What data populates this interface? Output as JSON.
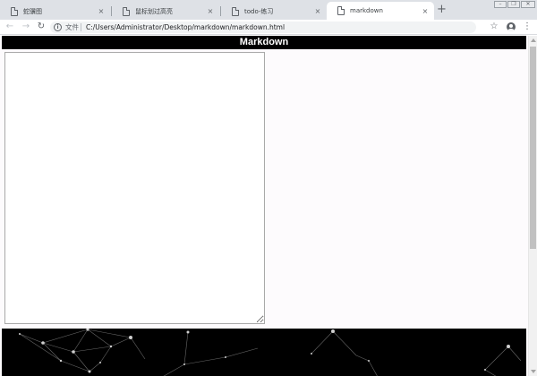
{
  "browser": {
    "tabs": [
      {
        "title": "蛇骥图",
        "close": "×",
        "active": false
      },
      {
        "title": "鼠标划过高亮",
        "close": "×",
        "active": false
      },
      {
        "title": "todo-练习",
        "close": "×",
        "active": false
      },
      {
        "title": "markdown",
        "close": "×",
        "active": true
      }
    ],
    "new_tab": "+",
    "window_controls": {
      "minimize": "–",
      "restore": "❐",
      "close": "✕"
    },
    "toolbar": {
      "back": "←",
      "forward": "→",
      "reload": "↻",
      "info": "i",
      "scheme_label": "文件",
      "url": "C:/Users/Administrator/Desktop/markdown/markdown.html",
      "bookmark": "☆",
      "menu": "⋮"
    }
  },
  "page": {
    "title": "Markdown",
    "editor_value": ""
  },
  "colors": {
    "header_bg": "#000000",
    "header_text": "#ffffff",
    "page_bg": "#fdfbfd",
    "particles_bg": "#000000"
  }
}
